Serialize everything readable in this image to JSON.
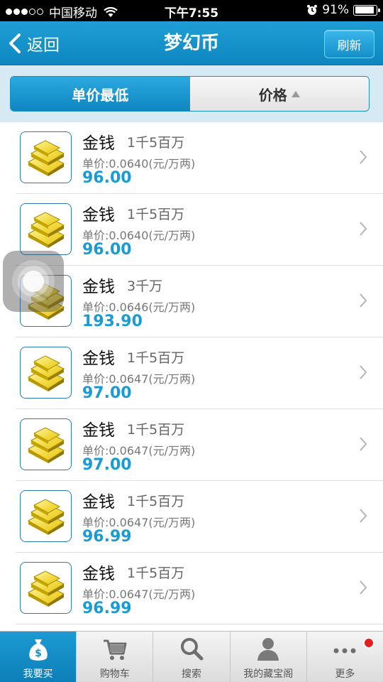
{
  "status_bar": {
    "carrier": "中国移动",
    "time": "下午7:55",
    "battery": "91%",
    "battery_level": 0.91
  },
  "nav": {
    "back_label": "返回",
    "title": "梦幻币",
    "refresh_label": "刷新"
  },
  "sort": {
    "tabs": [
      {
        "label": "单价最低",
        "active": true
      },
      {
        "label": "价格",
        "active": false
      }
    ]
  },
  "list": {
    "items": [
      {
        "name": "金钱",
        "qty": "1千5百万",
        "unit_price": "单价:0.0640(元/万两)",
        "price": "96.00"
      },
      {
        "name": "金钱",
        "qty": "1千5百万",
        "unit_price": "单价:0.0640(元/万两)",
        "price": "96.00"
      },
      {
        "name": "金钱",
        "qty": "3千万",
        "unit_price": "单价:0.0646(元/万两)",
        "price": "193.90"
      },
      {
        "name": "金钱",
        "qty": "1千5百万",
        "unit_price": "单价:0.0647(元/万两)",
        "price": "97.00"
      },
      {
        "name": "金钱",
        "qty": "1千5百万",
        "unit_price": "单价:0.0647(元/万两)",
        "price": "97.00"
      },
      {
        "name": "金钱",
        "qty": "1千5百万",
        "unit_price": "单价:0.0647(元/万两)",
        "price": "96.99"
      },
      {
        "name": "金钱",
        "qty": "1千5百万",
        "unit_price": "单价:0.0647(元/万两)",
        "price": "96.99"
      }
    ]
  },
  "tabbar": {
    "tabs": [
      {
        "label": "我要买",
        "icon": "money-bag-icon",
        "active": true
      },
      {
        "label": "购物车",
        "icon": "cart-icon",
        "active": false
      },
      {
        "label": "搜索",
        "icon": "search-icon",
        "active": false
      },
      {
        "label": "我的藏宝阁",
        "icon": "user-icon",
        "active": false
      },
      {
        "label": "更多",
        "icon": "more-icon",
        "active": false
      }
    ]
  },
  "colors": {
    "brand": "#1a9bd6",
    "price": "#1a9bd6",
    "badge": "#e02020"
  }
}
